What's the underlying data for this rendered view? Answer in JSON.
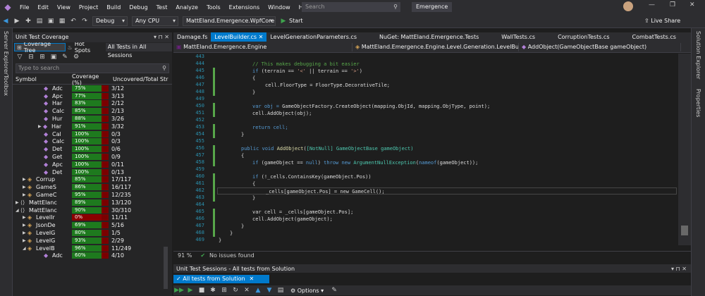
{
  "menu": {
    "items": [
      "File",
      "Edit",
      "View",
      "Project",
      "Build",
      "Debug",
      "Test",
      "Analyze",
      "Tools",
      "Extensions",
      "Window",
      "Help"
    ],
    "search_placeholder": "Search",
    "solution_name": "Emergence",
    "live_share": "Live Share"
  },
  "toolbar": {
    "config": "Debug",
    "platform": "Any CPU",
    "startup_project": "MattEland.Emergence.WpfCore",
    "start_label": "Start"
  },
  "side_labels": {
    "left": [
      "Server Explorer",
      "Toolbox"
    ],
    "right": [
      "Solution Explorer",
      "Properties"
    ]
  },
  "coverage": {
    "title": "Unit Test Coverage",
    "btn_tree": "Coverage Tree",
    "btn_hotspots": "Hot Spots",
    "filter": "All Tests in All Sessions",
    "search_placeholder": "Type to search",
    "col_symbol": "Symbol",
    "col_coverage": "Coverage (%)",
    "col_uncovered": "Uncovered/Total Str",
    "rows": [
      {
        "name": "Adc",
        "pct": "75%",
        "unc": "3/12",
        "exp": "",
        "kind": "m"
      },
      {
        "name": "Apc",
        "pct": "77%",
        "unc": "3/13",
        "exp": "",
        "kind": "m"
      },
      {
        "name": "Har",
        "pct": "83%",
        "unc": "2/12",
        "exp": "",
        "kind": "m"
      },
      {
        "name": "Calc",
        "pct": "85%",
        "unc": "2/13",
        "exp": "",
        "kind": "m"
      },
      {
        "name": "Hur",
        "pct": "88%",
        "unc": "3/26",
        "exp": "",
        "kind": "m"
      },
      {
        "name": "Har",
        "pct": "91%",
        "unc": "3/32",
        "exp": "▶",
        "kind": "m"
      },
      {
        "name": "Cal",
        "pct": "100%",
        "unc": "0/3",
        "exp": "",
        "kind": "m"
      },
      {
        "name": "Calc",
        "pct": "100%",
        "unc": "0/3",
        "exp": "",
        "kind": "m"
      },
      {
        "name": "Det",
        "pct": "100%",
        "unc": "0/6",
        "exp": "",
        "kind": "m"
      },
      {
        "name": "Get",
        "pct": "100%",
        "unc": "0/9",
        "exp": "",
        "kind": "m"
      },
      {
        "name": "Apc",
        "pct": "100%",
        "unc": "0/11",
        "exp": "",
        "kind": "m"
      },
      {
        "name": "Det",
        "pct": "100%",
        "unc": "0/13",
        "exp": "",
        "kind": "m"
      },
      {
        "name": "Corrup",
        "pct": "85%",
        "unc": "17/117",
        "exp": "▶",
        "kind": "c"
      },
      {
        "name": "GameS",
        "pct": "86%",
        "unc": "16/117",
        "exp": "▶",
        "kind": "c"
      },
      {
        "name": "GameC",
        "pct": "95%",
        "unc": "12/235",
        "exp": "▶",
        "kind": "c"
      },
      {
        "name": "MattElanc",
        "pct": "89%",
        "unc": "13/120",
        "exp": "▶",
        "kind": "n"
      },
      {
        "name": "MattElanc",
        "pct": "90%",
        "unc": "30/310",
        "exp": "◢",
        "kind": "n"
      },
      {
        "name": "LevelIr",
        "pct": "0%",
        "unc": "11/11",
        "exp": "▶",
        "kind": "c"
      },
      {
        "name": "JsonDe",
        "pct": "69%",
        "unc": "5/16",
        "exp": "▶",
        "kind": "c"
      },
      {
        "name": "LevelG",
        "pct": "80%",
        "unc": "1/5",
        "exp": "▶",
        "kind": "c"
      },
      {
        "name": "LevelG",
        "pct": "93%",
        "unc": "2/29",
        "exp": "▶",
        "kind": "c"
      },
      {
        "name": "LevelB",
        "pct": "96%",
        "unc": "11/249",
        "exp": "◢",
        "kind": "c"
      },
      {
        "name": "Adc",
        "pct": "60%",
        "unc": "4/10",
        "exp": "",
        "kind": "m"
      }
    ]
  },
  "tabs": [
    "Damage.fs",
    "LevelBuilder.cs",
    "LevelGenerationParameters.cs",
    "NuGet: MattEland.Emergence.Tests",
    "WallTests.cs",
    "CorruptionTests.cs",
    "CombatTests.cs"
  ],
  "nav": {
    "project": "MattEland.Emergence.Engine",
    "type": "MattEland.Emergence.Engine.Level.Generation.LevelBuilder",
    "member": "AddObject(GameObjectBase gameObject)"
  },
  "code": {
    "lines": [
      "443",
      "444",
      "445",
      "446",
      "447",
      "448",
      "449",
      "450",
      "451",
      "452",
      "453",
      "454",
      "455",
      "456",
      "457",
      "458",
      "459",
      "460",
      "461",
      "462",
      "463",
      "464",
      "465",
      "466",
      "467",
      "468",
      "469"
    ],
    "l444": "// This makes debugging a bit easier",
    "l450_var": "var obj = ",
    "l450_call": "GameObjectFactory.CreateObject(mapping.ObjId, mapping.ObjType, point);",
    "l451": "cell.AddObject(obj);",
    "l453": "return cell;",
    "l456_attr": "[NotNull]",
    "l456_sig": "GameObjectBase gameObject)",
    "l458_throw": "ArgumentNullException",
    "l460": "(!_cells.ContainsKey(gameObject.Pos))",
    "l462": "_cells[gameObject.Pos] = new GameCell();",
    "l465": "var cell = _cells[gameObject.Pos];",
    "l466": "cell.AddObject(gameObject);"
  },
  "status": {
    "zoom": "91 %",
    "issues": "No issues found"
  },
  "sessions": {
    "title": "Unit Test Sessions - All tests from Solution",
    "tab": "All tests from Solution",
    "options": "Options"
  }
}
